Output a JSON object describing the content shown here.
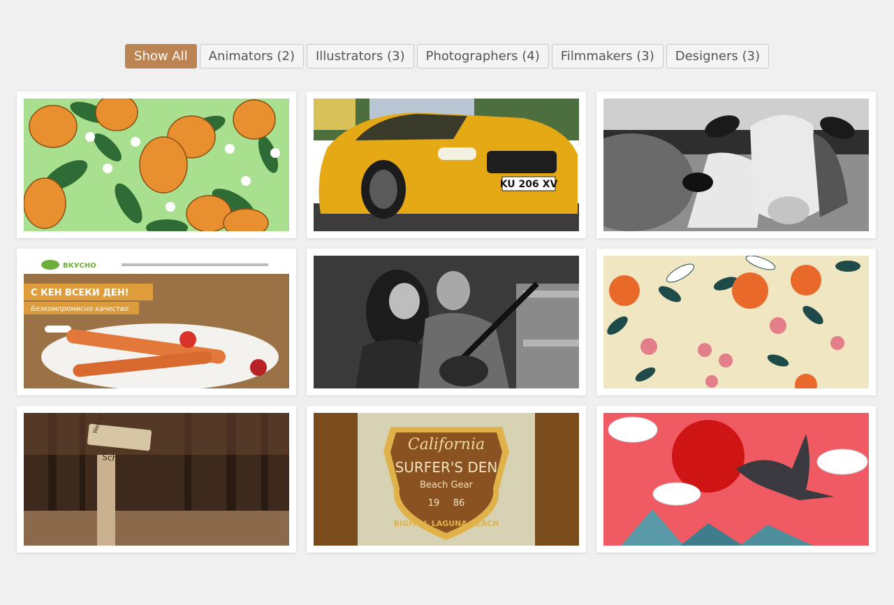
{
  "filters": [
    {
      "label": "Show All"
    },
    {
      "label": "Animators (2)"
    },
    {
      "label": "Illustrators (3)"
    },
    {
      "label": "Photographers (4)"
    },
    {
      "label": "Filmmakers (3)"
    },
    {
      "label": "Designers (3)"
    }
  ],
  "active_filter": "Show All",
  "accent_color": "#bb8452",
  "gallery": {
    "vksno": {
      "logo": "ВКУСНО",
      "headline": "С КЕН ВСЕКИ ДЕН!",
      "tagline": "Безкомпромисно качество"
    },
    "car": {
      "plate": "KU 206 XV"
    },
    "sign": {
      "top": "Weg 12",
      "main": "Schöngänge"
    },
    "badge": {
      "script": "California",
      "title": "SURFER'S DEN",
      "sub": "Beach Gear",
      "year_left": "19",
      "year_right": "86",
      "arc": "BIGFALL LAGUNA BEACH"
    }
  }
}
